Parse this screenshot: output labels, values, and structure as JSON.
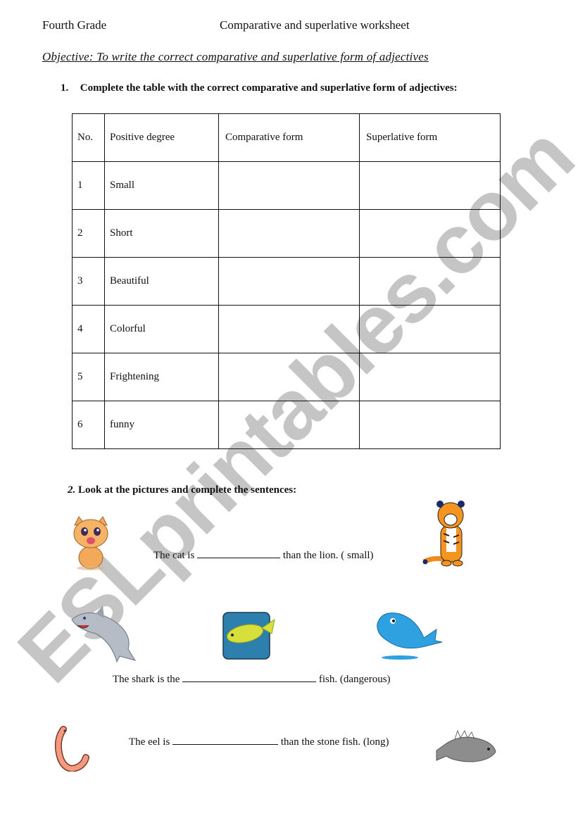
{
  "header": {
    "grade": "Fourth Grade",
    "title": "Comparative and superlative worksheet"
  },
  "objective": "Objective: To write the correct comparative and superlative form of adjectives",
  "exercise1": {
    "number": "1.",
    "instruction": "Complete the table with the correct comparative and superlative form of adjectives:",
    "table": {
      "headers": [
        "No.",
        "Positive degree",
        "Comparative form",
        "Superlative form"
      ],
      "rows": [
        [
          "1",
          "Small",
          "",
          ""
        ],
        [
          "2",
          "Short",
          "",
          ""
        ],
        [
          "3",
          "Beautiful",
          "",
          ""
        ],
        [
          "4",
          "Colorful",
          "",
          ""
        ],
        [
          "5",
          "Frightening",
          "",
          ""
        ],
        [
          "6",
          "funny",
          "",
          ""
        ]
      ]
    }
  },
  "exercise2": {
    "number": "2.",
    "instruction": "Look at the pictures and complete the sentences:",
    "sentences": [
      {
        "before": "The cat is",
        "after": "than the lion. ( small)"
      },
      {
        "before": "The shark is the",
        "after": "fish. (dangerous)"
      },
      {
        "before": "The eel is",
        "after": "than the stone fish. (long)"
      }
    ],
    "pictures": [
      "cat",
      "tiger",
      "shark",
      "yellow-fish",
      "whale",
      "eel",
      "stone-fish"
    ]
  },
  "watermark": "ESLprintables.com"
}
